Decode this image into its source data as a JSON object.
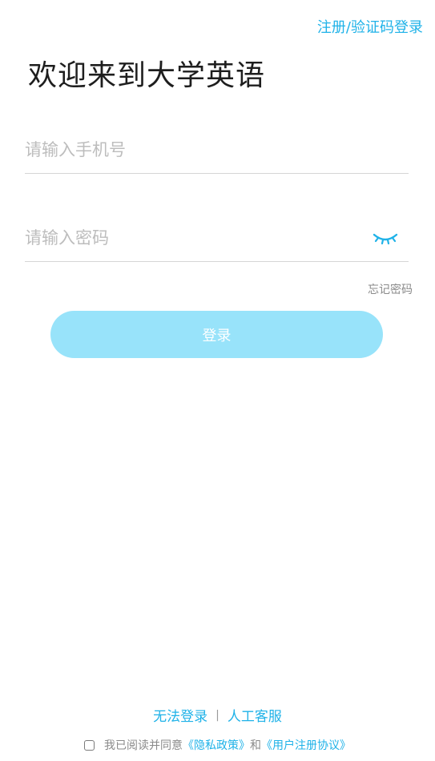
{
  "header": {
    "register_link": "注册/验证码登录",
    "title": "欢迎来到大学英语"
  },
  "form": {
    "phone_placeholder": "请输入手机号",
    "phone_value": "",
    "password_placeholder": "请输入密码",
    "password_value": "",
    "toggle_icon": "eye-closed-icon",
    "forgot_password": "忘记密码",
    "login_button": "登录"
  },
  "footer": {
    "cannot_login": "无法登录",
    "separator": "|",
    "customer_service": "人工客服",
    "agreement_prefix": "我已阅读并同意",
    "privacy_policy": "《隐私政策》",
    "and": "和",
    "user_agreement": "《用户注册协议》"
  },
  "colors": {
    "accent": "#1FB2E8",
    "button_bg": "#98E3FA",
    "text_muted": "#8a8a8a",
    "placeholder": "#bdbdbd"
  }
}
